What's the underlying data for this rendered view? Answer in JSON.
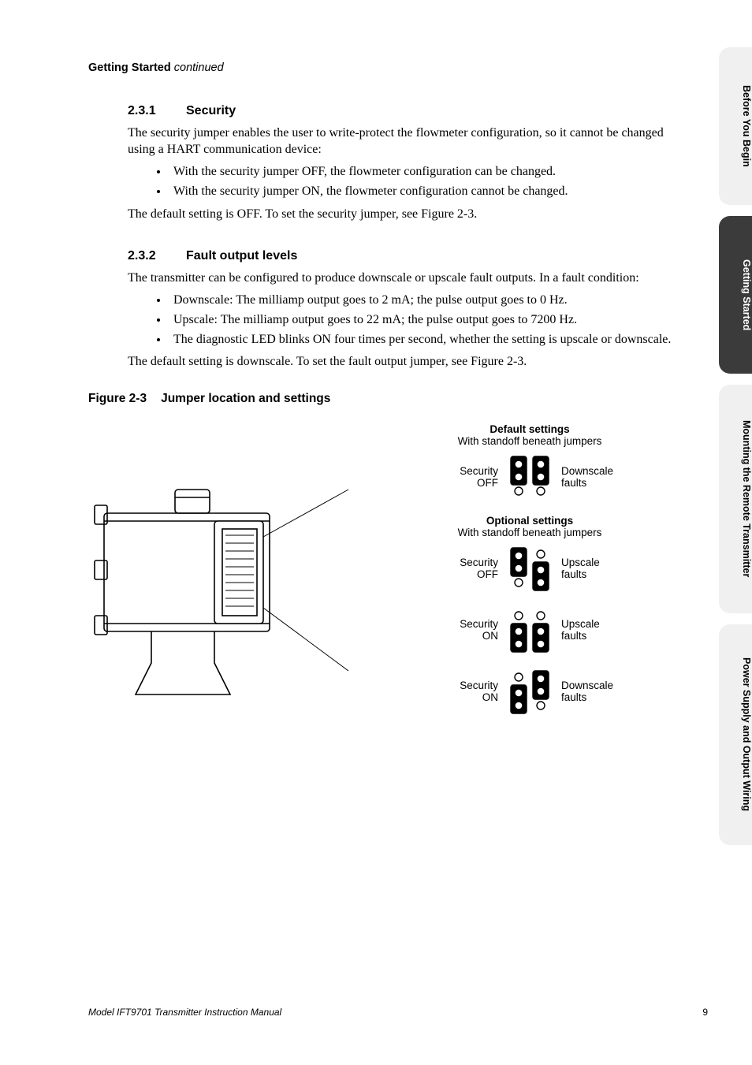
{
  "running_head": {
    "bold": "Getting Started",
    "italic": " continued"
  },
  "sec1": {
    "num": "2.3.1",
    "title": "Security",
    "p1": "The security jumper enables the user to write-protect the flowmeter configuration, so it cannot be changed using a HART communication device:",
    "b1": "With the security jumper OFF, the flowmeter configuration can be changed.",
    "b2": "With the security jumper ON, the flowmeter configuration cannot be changed.",
    "p2": "The default setting is OFF. To set the security jumper, see Figure 2-3."
  },
  "sec2": {
    "num": "2.3.2",
    "title": "Fault output levels",
    "p1": "The transmitter can be configured to produce downscale or upscale fault outputs. In a fault condition:",
    "b1": "Downscale: The milliamp output goes to 2 mA; the pulse output goes to 0 Hz.",
    "b2": "Upscale: The milliamp output goes to 22 mA; the pulse output goes to 7200 Hz.",
    "b3": "The diagnostic LED blinks ON four times per second, whether the setting is upscale or downscale.",
    "p2": "The default setting is downscale. To set the fault output jumper, see Figure 2-3."
  },
  "figure": {
    "num": "Figure 2-3",
    "title": "Jumper location and settings",
    "default_title": "Default settings",
    "default_sub": "With standoff beneath jumpers",
    "optional_title": "Optional settings",
    "optional_sub": "With standoff beneath jumpers",
    "labels": {
      "sec_off": "Security\nOFF",
      "sec_on": "Security\nON",
      "down": "Downscale\nfaults",
      "up": "Upscale\nfaults"
    }
  },
  "footer": {
    "left": "Model IFT9701 Transmitter Instruction Manual",
    "right": "9"
  },
  "tabs": {
    "t1": "Before You Begin",
    "t2": "Getting Started",
    "t3": "Mounting the Remote Transmitter",
    "t4": "Power Supply and Output Wiring"
  }
}
